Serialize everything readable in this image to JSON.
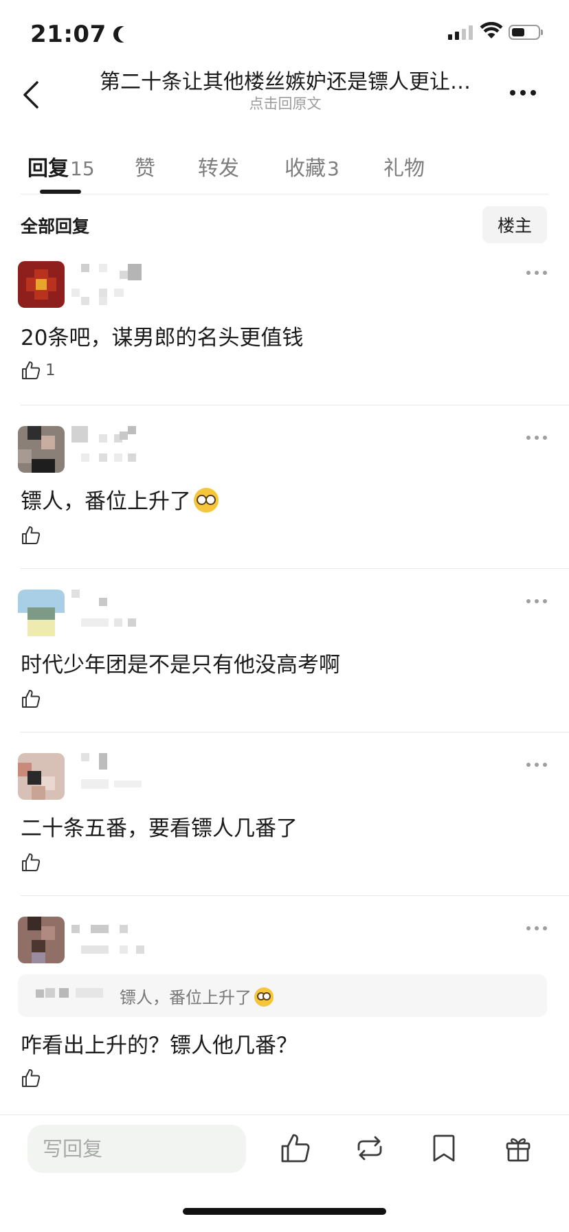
{
  "status_bar": {
    "time": "21:07"
  },
  "header": {
    "title": "第二十条让其他楼丝嫉妒还是镖人更让…",
    "subtitle": "点击回原文"
  },
  "tabs": [
    {
      "label": "回复",
      "count": "15",
      "active": true
    },
    {
      "label": "赞",
      "count": "",
      "active": false
    },
    {
      "label": "转发",
      "count": "",
      "active": false
    },
    {
      "label": "收藏",
      "count": "3",
      "active": false
    },
    {
      "label": "礼物",
      "count": "",
      "active": false
    }
  ],
  "section": {
    "title": "全部回复",
    "filter_label": "楼主"
  },
  "comments": [
    {
      "text": "20条吧，谋男郎的名头更值钱",
      "likes": "1"
    },
    {
      "text": "镖人，番位上升了",
      "likes": ""
    },
    {
      "text": "时代少年团是不是只有他没高考啊",
      "likes": ""
    },
    {
      "text": "二十条五番，要看镖人几番了",
      "likes": ""
    },
    {
      "text": "咋看出上升的？镖人他几番？",
      "likes": "",
      "quote": "镖人，番位上升了"
    }
  ],
  "bottom_bar": {
    "reply_placeholder": "写回复",
    "icons": [
      "like-icon",
      "repost-icon",
      "bookmark-icon",
      "gift-icon"
    ]
  },
  "colors": {
    "text_primary": "#1a1a1a",
    "text_secondary": "#7d7d7d",
    "text_muted": "#9b9b9b",
    "divider": "#e6e6e6",
    "chip_bg": "#f3f3f3"
  }
}
